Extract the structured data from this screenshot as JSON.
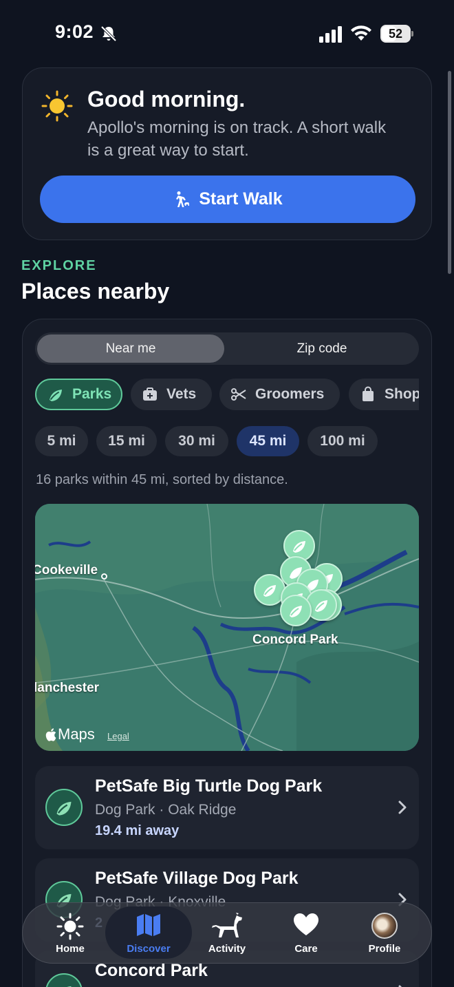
{
  "status_bar": {
    "time": "9:02",
    "battery": "52",
    "battery_fraction": 0.52
  },
  "greeting": {
    "title": "Good morning.",
    "subtitle": "Apollo's morning is on track. A short walk is a great way to start.",
    "button_label": "Start Walk"
  },
  "explore": {
    "eyebrow": "EXPLORE",
    "title": "Places nearby"
  },
  "location_mode": {
    "options": [
      "Near me",
      "Zip code"
    ],
    "selected": "Near me"
  },
  "categories": [
    {
      "label": "Parks",
      "icon": "leaf-icon",
      "active": true
    },
    {
      "label": "Vets",
      "icon": "medical-bag-icon",
      "active": false
    },
    {
      "label": "Groomers",
      "icon": "scissors-icon",
      "active": false
    },
    {
      "label": "Shop",
      "icon": "shopping-bag-icon",
      "active": false
    }
  ],
  "distances": [
    {
      "label": "5 mi",
      "active": false
    },
    {
      "label": "15 mi",
      "active": false
    },
    {
      "label": "30 mi",
      "active": false
    },
    {
      "label": "45 mi",
      "active": true
    },
    {
      "label": "100 mi",
      "active": false
    }
  ],
  "results_summary": "16 parks within 45 mi, sorted by distance.",
  "map": {
    "labels": [
      "Cookeville",
      "Concord Park",
      "lanchester"
    ],
    "brand": "Maps",
    "legal": "Legal",
    "pin_icon": "leaf-icon"
  },
  "parks": [
    {
      "name": "PetSafe Big Turtle Dog Park",
      "meta": "Dog Park · Oak Ridge",
      "distance": "19.4 mi away"
    },
    {
      "name": "PetSafe Village Dog Park",
      "meta": "Dog Park · Knoxville",
      "distance": "2"
    },
    {
      "name": "Concord Park",
      "meta": "",
      "distance": ""
    }
  ],
  "tab_bar": {
    "tabs": [
      {
        "label": "Home",
        "icon": "sun-icon"
      },
      {
        "label": "Discover",
        "icon": "map-icon",
        "active": true
      },
      {
        "label": "Activity",
        "icon": "dog-icon"
      },
      {
        "label": "Care",
        "icon": "heart-icon"
      },
      {
        "label": "Profile",
        "icon": "avatar"
      }
    ]
  },
  "colors": {
    "background": "#0f1420",
    "accent_blue": "#3b73ec",
    "accent_green": "#5fd3a3",
    "map_water": "#1d3d8a"
  }
}
